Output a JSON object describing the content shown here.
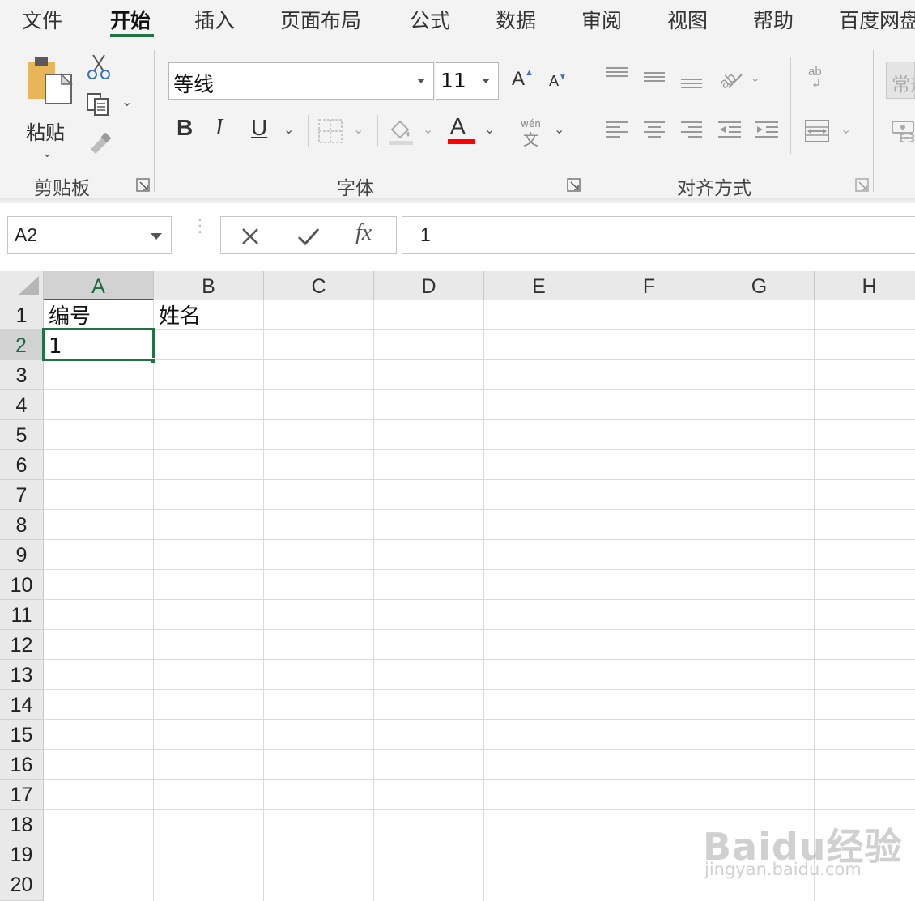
{
  "ribbon_tabs": [
    "文件",
    "开始",
    "插入",
    "页面布局",
    "公式",
    "数据",
    "审阅",
    "视图",
    "帮助",
    "百度网盘"
  ],
  "active_tab": "开始",
  "clipboard": {
    "paste_label": "粘贴",
    "group_label": "剪贴板"
  },
  "font": {
    "font_name": "等线",
    "font_size": "11",
    "group_label": "字体",
    "bold": "B",
    "italic": "I",
    "underline": "U",
    "grow": "A",
    "shrink": "A",
    "font_color_glyph": "A",
    "font_color": "#ff0000",
    "phonetic_top": "wén",
    "phonetic_bottom": "文"
  },
  "alignment": {
    "group_label": "对齐方式",
    "wrap_glyph": "ab"
  },
  "number": {
    "format_value": "常规"
  },
  "formula_bar": {
    "name_box": "A2",
    "fx_label": "fx",
    "formula_value": "1"
  },
  "sheet": {
    "columns": [
      "A",
      "B",
      "C",
      "D",
      "E",
      "F",
      "G",
      "H"
    ],
    "rows": [
      "1",
      "2",
      "3",
      "4",
      "5",
      "6",
      "7",
      "8",
      "9",
      "10",
      "11",
      "12",
      "13",
      "14",
      "15",
      "16",
      "17",
      "18",
      "19",
      "20"
    ],
    "cells": {
      "A1": "编号",
      "B1": "姓名",
      "A2": "1"
    },
    "selected_cell": "A2",
    "accent_color": "#217346"
  },
  "watermark": {
    "logo": "Baidu经验",
    "url": "jingyan.baidu.com"
  }
}
